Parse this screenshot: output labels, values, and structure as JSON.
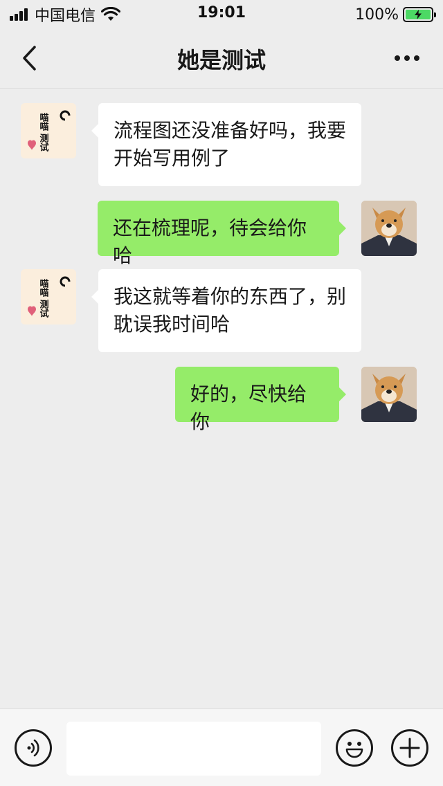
{
  "status_bar": {
    "carrier": "中国电信",
    "time": "19:01",
    "battery_percent": "100%",
    "battery_level": 1.0
  },
  "header": {
    "title": "她是测试",
    "back_icon": "chevron-left-icon",
    "more_icon": "ellipsis-icon"
  },
  "contact_avatar": {
    "text_line1": "喵喵",
    "text_line2": "测试"
  },
  "messages": [
    {
      "sender": "contact",
      "text": "流程图还没准备好吗，我要开始写用例了"
    },
    {
      "sender": "me",
      "text": "还在梳理呢，待会给你哈"
    },
    {
      "sender": "contact",
      "text": "我这就等着你的东西了，别耽误我时间哈"
    },
    {
      "sender": "me",
      "text": "好的，尽快给你"
    }
  ],
  "input_bar": {
    "voice_icon": "voice-icon",
    "message_value": "",
    "emoji_icon": "emoji-icon",
    "plus_icon": "plus-icon"
  },
  "colors": {
    "background": "#ededed",
    "incoming_bubble": "#ffffff",
    "outgoing_bubble": "#95ec69",
    "battery_fill": "#4cd964"
  }
}
